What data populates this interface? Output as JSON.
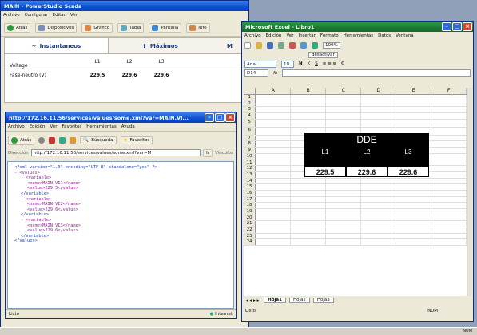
{
  "main": {
    "title": "MAIN - PowerStudio Scada",
    "menu": [
      "Archivo",
      "Configurar",
      "Editar",
      "Ver"
    ],
    "toolbar": [
      "Atrás",
      "Dispositivos",
      "Gráfico",
      "Tabla",
      "Pantalla",
      "Info"
    ],
    "tabs": [
      "Instantaneos",
      "Máximos",
      "M"
    ],
    "headers": [
      "L1",
      "L2",
      "L3"
    ],
    "row_label_header": "Voltage",
    "row": {
      "label": "Fase-neutro (V)",
      "values": [
        "229,5",
        "229,6",
        "229,6"
      ]
    }
  },
  "xml": {
    "title": "http://172.16.11.56/services/values/some.xml?var=MAIN.VI...",
    "menu": [
      "Archivo",
      "Edición",
      "Ver",
      "Favoritos",
      "Herramientas",
      "Ayuda"
    ],
    "back": "Atrás",
    "search": "Búsqueda",
    "favorites": "Favoritos",
    "addr_label": "Dirección",
    "url": "http://172.16.11.56/services/values/some.xml?var=M",
    "go": "Ir",
    "links": "Vínculos",
    "lines": [
      {
        "i": 0,
        "t": "<?xml version=\"1.0\" encoding=\"UTF-8\" standalone=\"yes\" ?>"
      },
      {
        "i": 0,
        "t": "- <values>"
      },
      {
        "i": 1,
        "t": "- <variable>"
      },
      {
        "i": 2,
        "t": "<name>MAIN.VI1</name>"
      },
      {
        "i": 2,
        "t": "<value>229.5</value>"
      },
      {
        "i": 1,
        "t": "</variable>"
      },
      {
        "i": 1,
        "t": "- <variable>"
      },
      {
        "i": 2,
        "t": "<name>MAIN.VI2</name>"
      },
      {
        "i": 2,
        "t": "<value>229.6</value>"
      },
      {
        "i": 1,
        "t": "</variable>"
      },
      {
        "i": 1,
        "t": "- <variable>"
      },
      {
        "i": 2,
        "t": "<name>MAIN.VI3</name>"
      },
      {
        "i": 2,
        "t": "<value>229.6</value>"
      },
      {
        "i": 1,
        "t": "</variable>"
      },
      {
        "i": 0,
        "t": "</values>"
      }
    ],
    "status_left": "Listo",
    "status_right": "Internet"
  },
  "excel": {
    "title": "Microsoft Excel - Libro1",
    "menu": [
      "Archivo",
      "Edición",
      "Ver",
      "Insertar",
      "Formato",
      "Herramientas",
      "Datos",
      "Ventana"
    ],
    "zoom": "100%",
    "security": "desactivar",
    "font": "Arial",
    "size": "10",
    "cell": "D14",
    "fx": "fx",
    "cols": [
      "A",
      "B",
      "C",
      "D",
      "E",
      "F"
    ],
    "rows": [
      "1",
      "2",
      "3",
      "4",
      "5",
      "6",
      "7",
      "8",
      "9",
      "10",
      "11",
      "12",
      "13",
      "14",
      "15",
      "16",
      "17",
      "18",
      "19",
      "20",
      "21",
      "22",
      "23",
      "24"
    ],
    "dde_title": "DDE",
    "dde_labels": [
      "L1",
      "L2",
      "L3"
    ],
    "dde_values": [
      "229.5",
      "229.6",
      "229.6"
    ],
    "sheets": [
      "Hoja1",
      "Hoja2",
      "Hoja3"
    ],
    "status_left": "Listo",
    "status_right": "NUM"
  },
  "taskbar": {
    "right": "NUM"
  }
}
